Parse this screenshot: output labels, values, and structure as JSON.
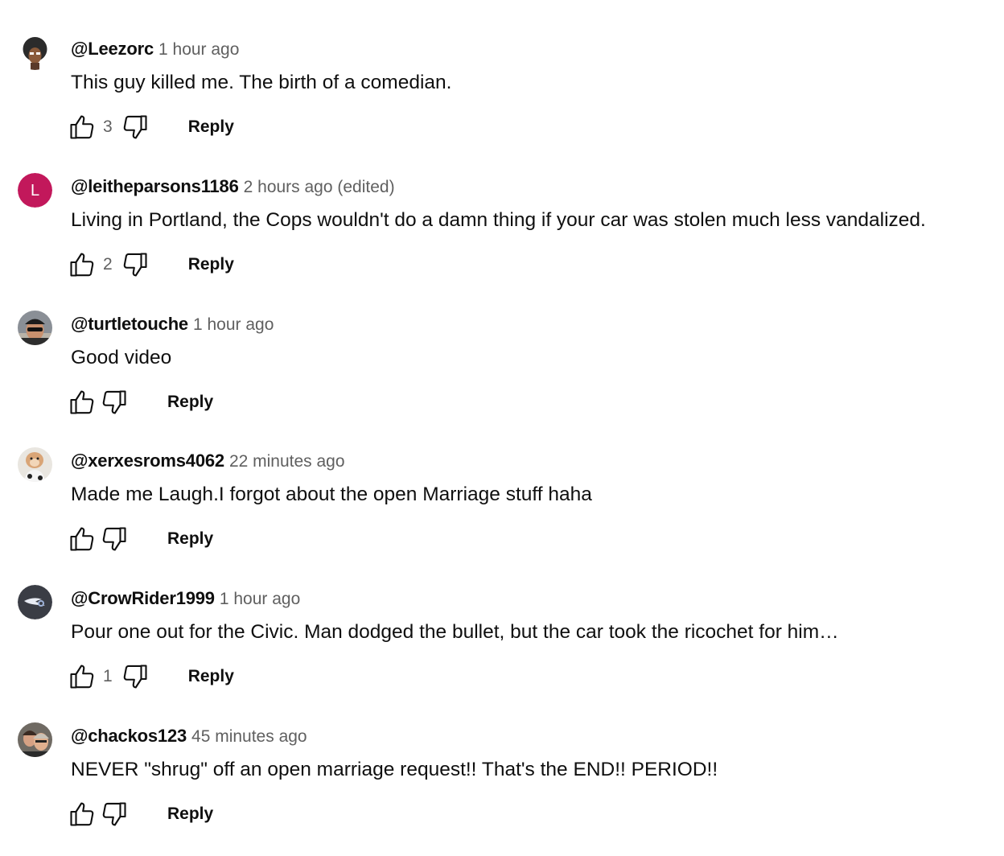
{
  "comments": [
    {
      "author": "@Leezorc",
      "time": "1 hour ago",
      "text": "This guy killed me. The birth of a comedian.",
      "likes": "3",
      "reply_label": "Reply",
      "avatar": {
        "kind": "cartoon-face",
        "bg": "#2b2b2b"
      }
    },
    {
      "author": "@leitheparsons1186",
      "time": "2 hours ago (edited)",
      "text": "Living in Portland, the Cops wouldn't do a damn thing if your car was stolen much less vandalized.",
      "likes": "2",
      "reply_label": "Reply",
      "avatar": {
        "kind": "letter",
        "letter": "L",
        "bg": "#c2185b"
      }
    },
    {
      "author": "@turtletouche",
      "time": "1 hour ago",
      "text": "Good video",
      "likes": "",
      "reply_label": "Reply",
      "avatar": {
        "kind": "photo-man-cap",
        "bg": "#8a8f96"
      }
    },
    {
      "author": "@xerxesroms4062",
      "time": "22 minutes ago",
      "text": "Made me Laugh.I forgot about the open Marriage stuff haha",
      "likes": "",
      "reply_label": "Reply",
      "avatar": {
        "kind": "cartoon-dog",
        "bg": "#e9e6e0"
      }
    },
    {
      "author": "@CrowRider1999",
      "time": "1 hour ago",
      "text": "Pour one out for the Civic. Man dodged the bullet, but the car took the ricochet for him…",
      "likes": "1",
      "reply_label": "Reply",
      "avatar": {
        "kind": "crow-logo",
        "bg": "#3a3d45"
      }
    },
    {
      "author": "@chackos123",
      "time": "45 minutes ago",
      "text": "NEVER \"shrug\" off an open marriage request!!  That's the END!!  PERIOD!!",
      "likes": "",
      "reply_label": "Reply",
      "avatar": {
        "kind": "photo-couple",
        "bg": "#6f6a63"
      }
    }
  ],
  "icons": {
    "like": "thumbs-up-icon",
    "dislike": "thumbs-down-icon"
  }
}
